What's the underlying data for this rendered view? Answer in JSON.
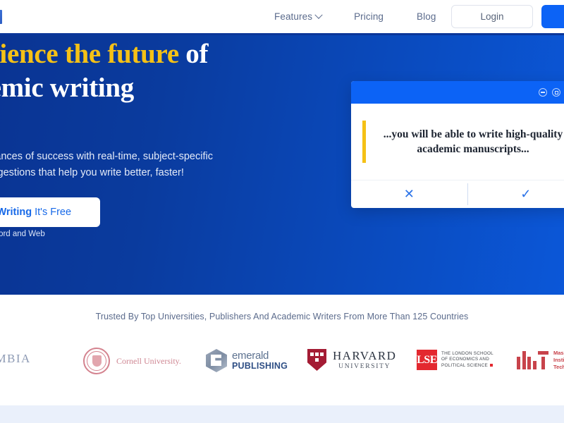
{
  "nav": {
    "logo_alt": "logo-mark",
    "links": [
      {
        "label": "Features",
        "has_dropdown": true
      },
      {
        "label": "Pricing",
        "has_dropdown": false
      },
      {
        "label": "Blog",
        "has_dropdown": false
      }
    ],
    "login_label": "Login",
    "cta_label": ""
  },
  "hero": {
    "title_part1": "perience the future",
    "title_part2": " of",
    "title_line2": "ademic writing",
    "subtitle_line1": "our chances of success with real-time, subject-specific",
    "subtitle_line2": "ge suggestions that help you write better, faster!",
    "cta_bold": "rt Writing",
    "cta_rest": "It's Free",
    "note": "on MS Word and Web",
    "carousel": {
      "total": 3,
      "active_index": 0
    },
    "bg_gradient_from": "#0a3493",
    "bg_gradient_to": "#0b57d8",
    "accent_gold": "#f5c116"
  },
  "card": {
    "window_controls": [
      "minimize-icon",
      "maximize-icon",
      "close-icon"
    ],
    "quote": "...you will be able to write high-quality academic manuscripts...",
    "reject_icon": "✕",
    "accept_icon": "✓",
    "titlebar_color": "#0c63f6",
    "quote_bar_color": "#f5c116"
  },
  "trust": {
    "headline": "Trusted By Top Universities, Publishers And Academic Writers From More Than 125 Countries",
    "logos": [
      {
        "name": "Columbia",
        "text": "OLUMBIA",
        "color": "#8d9ab4"
      },
      {
        "name": "Cornell University",
        "text": "Cornell University.",
        "color": "#cf8793"
      },
      {
        "name": "Emerald Publishing",
        "text_top": "emerald",
        "text_bottom": "PUBLISHING",
        "color": "#2f4f85"
      },
      {
        "name": "Harvard University",
        "text_top": "HARVARD",
        "text_bottom": "UNIVERSITY",
        "color": "#a41c34"
      },
      {
        "name": "London School of Economics",
        "mark": "LSE",
        "line1": "THE LONDON SCHOOL",
        "line2": "OF ECONOMICS AND",
        "line3": "POLITICAL SCIENCE",
        "color": "#e3282f"
      },
      {
        "name": "MIT",
        "line1": "Massa",
        "line2": "Institu",
        "line3": "Techn",
        "color": "#c8434b"
      }
    ]
  },
  "bottom": {
    "bg_color": "#eaf0fb"
  }
}
